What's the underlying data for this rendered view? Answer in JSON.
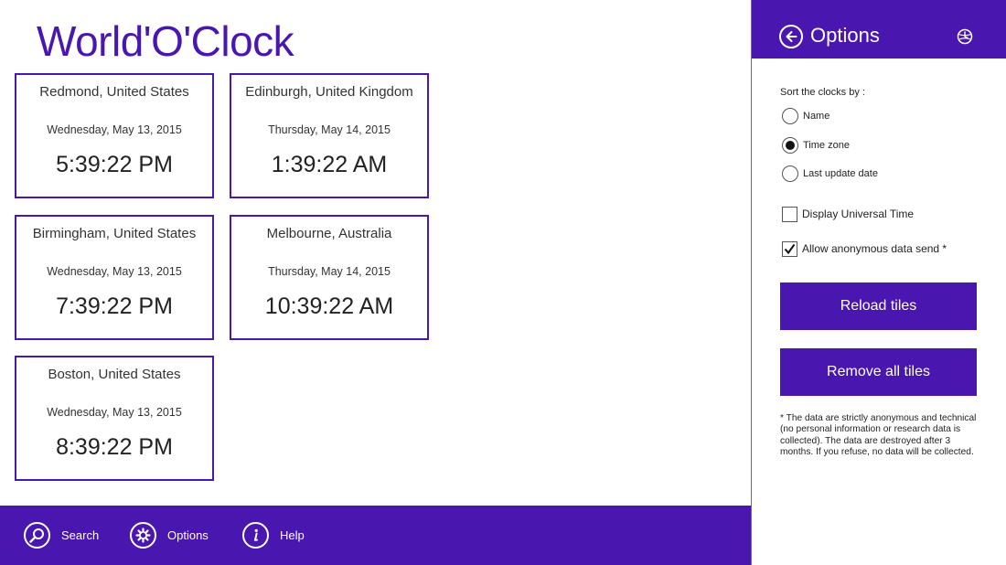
{
  "app": {
    "title": "World'O'Clock"
  },
  "tiles": [
    {
      "city": "Redmond, United States",
      "date": "Wednesday, May 13, 2015",
      "time": "5:39:22 PM"
    },
    {
      "city": "Edinburgh, United Kingdom",
      "date": "Thursday, May 14, 2015",
      "time": "1:39:22 AM"
    },
    {
      "city": "Birmingham, United States",
      "date": "Wednesday, May 13, 2015",
      "time": "7:39:22 PM"
    },
    {
      "city": "Melbourne, Australia",
      "date": "Thursday, May 14, 2015",
      "time": "10:39:22 AM"
    },
    {
      "city": "Boston, United States",
      "date": "Wednesday, May 13, 2015",
      "time": "8:39:22 PM"
    }
  ],
  "appbar": {
    "search": {
      "label": "Search",
      "icon": "search-icon"
    },
    "options": {
      "label": "Options",
      "icon": "gear-icon"
    },
    "help": {
      "label": "Help",
      "icon": "info-icon"
    }
  },
  "options_panel": {
    "title": "Options",
    "sort_label": "Sort the clocks by :",
    "sort_options": [
      {
        "label": "Name",
        "selected": false
      },
      {
        "label": "Time zone",
        "selected": true
      },
      {
        "label": "Last update date",
        "selected": false
      }
    ],
    "checkboxes": [
      {
        "label": "Display Universal Time",
        "checked": false
      },
      {
        "label": "Allow anonymous data send *",
        "checked": true
      }
    ],
    "reload_label": "Reload tiles",
    "remove_label": "Remove all tiles",
    "disclaimer": "* The data are strictly anonymous and technical (no personal information or research data is collected). The data are destroyed after 3 months. If you refuse, no data will be collected."
  },
  "colors": {
    "accent": "#4a16b0",
    "background": "#ffffff",
    "text": "#222222"
  }
}
